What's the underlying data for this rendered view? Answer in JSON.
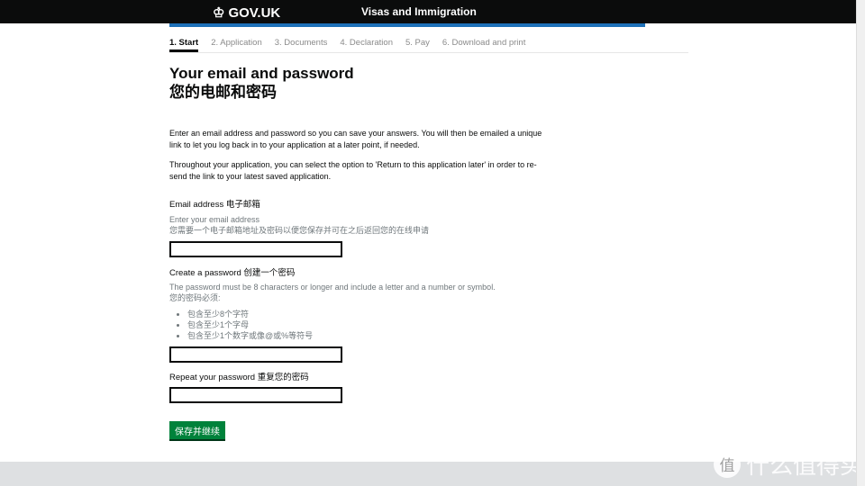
{
  "header": {
    "logo": "GOV.UK",
    "service": "Visas and Immigration"
  },
  "steps": [
    "1. Start",
    "2. Application",
    "3. Documents",
    "4. Declaration",
    "5. Pay",
    "6. Download and print"
  ],
  "title_en": "Your email and password",
  "title_zh": "您的电邮和密码",
  "intro1": "Enter an email address and password so you can save your answers. You will then be emailed a unique link to let you log back in to your application at a later point, if needed.",
  "intro2": "Throughout your application, you can select the option to 'Return to this application later' in order to re-send the link to your latest saved application.",
  "email": {
    "label": "Email address 电子邮箱",
    "hint": "Enter your email address",
    "hint_zh": "您需要一个电子邮箱地址及密码以便您保存并可在之后返回您的在线申请",
    "value": ""
  },
  "password": {
    "label": "Create a password 创建一个密码",
    "hint": "The password must be 8 characters or longer and include a letter and a number or symbol.",
    "hint_zh": "您的密码必须:",
    "rules": [
      "包含至少8个字符",
      "包含至少1个字母",
      "包含至少1个数字或像@或%等符号"
    ],
    "value": ""
  },
  "repeat": {
    "label": "Repeat your password 重复您的密码",
    "value": ""
  },
  "submit": "保存并继续",
  "watermark": {
    "badge": "值",
    "text": "什么值得买"
  }
}
